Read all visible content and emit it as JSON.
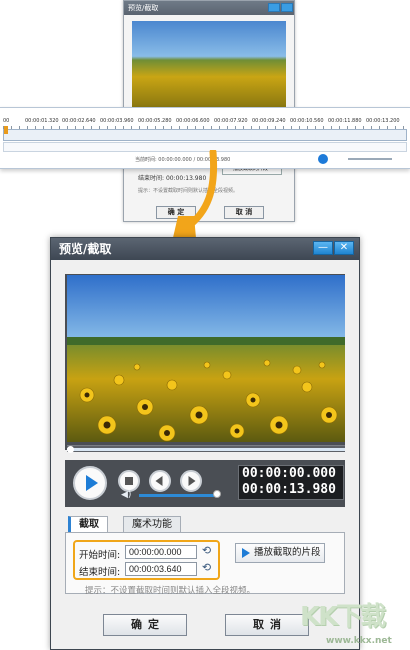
{
  "small_dialog": {
    "title": "预览/截取",
    "end_time_label": "结束时间:",
    "end_time_value": "00:00:13.980",
    "play_clip": "播放截取的片段",
    "hint": "提示：不设置截取时间则默认插入全段视频。",
    "ok": "确 定",
    "cancel": "取 消"
  },
  "timeline": {
    "ruler_labels": [
      "00",
      "00:00:01.320",
      "00:00:02.640",
      "00:00:03.960",
      "00:00:05.280",
      "00:00:06.600",
      "00:00:07.920",
      "00:00:09.240",
      "00:00:10.560",
      "00:00:11.880",
      "00:00:13.200"
    ],
    "current_time": "当前时间: 00:00:00.000 / 00:00:13.980"
  },
  "dialog": {
    "title": "预览/截取",
    "minimize": "—",
    "close": "✕",
    "time_current": "00:00:00.000",
    "time_total": "00:00:13.980",
    "tabs": [
      "截取",
      "魔术功能"
    ],
    "start_label": "开始时间:",
    "start_value": "00:00:00.000",
    "end_label": "结束时间:",
    "end_value": "00:00:03.640",
    "play_clip": "播放截取的片段",
    "hint": "提示：不设置截取时间则默认插入全段视频。",
    "ok": "确定",
    "cancel": "取消"
  },
  "watermark": {
    "text": "KK下载",
    "url": "www.kkx.net"
  },
  "colors": {
    "accent": "#1d7cd6",
    "highlight": "#f0a619",
    "titlebar": "#4a535e"
  }
}
